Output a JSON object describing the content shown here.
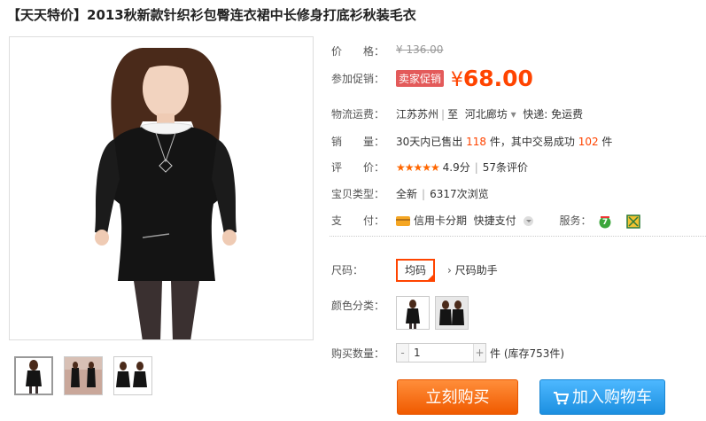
{
  "title": "【天天特价】2013秋新款针织衫包臀连衣裙中长修身打底衫秋装毛衣",
  "price": {
    "label": "价　　格：",
    "original": "¥ 136.00"
  },
  "promo": {
    "label": "参加促销：",
    "tag": "卖家促销",
    "currency": "¥",
    "amount": "68.00"
  },
  "shipping": {
    "label": "物流运费：",
    "from": "江苏苏州",
    "to": "河北廊坊",
    "separator": "至",
    "arrow": "▾",
    "fee": "快递: 免运费"
  },
  "sales": {
    "label": "销　　量：",
    "prefix": "30天内已售出",
    "count": "118",
    "mid": "件，其中交易成功",
    "success": "102",
    "suffix": "件"
  },
  "rating": {
    "label": "评　　价：",
    "stars": "★★★★★",
    "score": "4.9分",
    "reviews": "57条评价"
  },
  "item_type": {
    "label": "宝贝类型：",
    "condition": "全新",
    "views": "6317次浏览"
  },
  "payment": {
    "label": "支　　付：",
    "credit": "信用卡分期",
    "quick": "快捷支付",
    "service_label": "服务：",
    "icon_7": "7"
  },
  "size": {
    "label": "尺码：",
    "option": "均码",
    "helper": "尺码助手",
    "helper_arrow": "›"
  },
  "color": {
    "label": "颜色分类："
  },
  "quantity": {
    "label": "购买数量：",
    "value": "1",
    "minus": "-",
    "plus": "+",
    "unit": "件 (库存753件)"
  },
  "actions": {
    "buy": "立刻购买",
    "cart": "加入购物车"
  },
  "colors": {
    "accent": "#ff4400",
    "promo_tag": "#e35a5a",
    "buy_button": "#f05a00",
    "cart_button": "#1c8fe0"
  }
}
